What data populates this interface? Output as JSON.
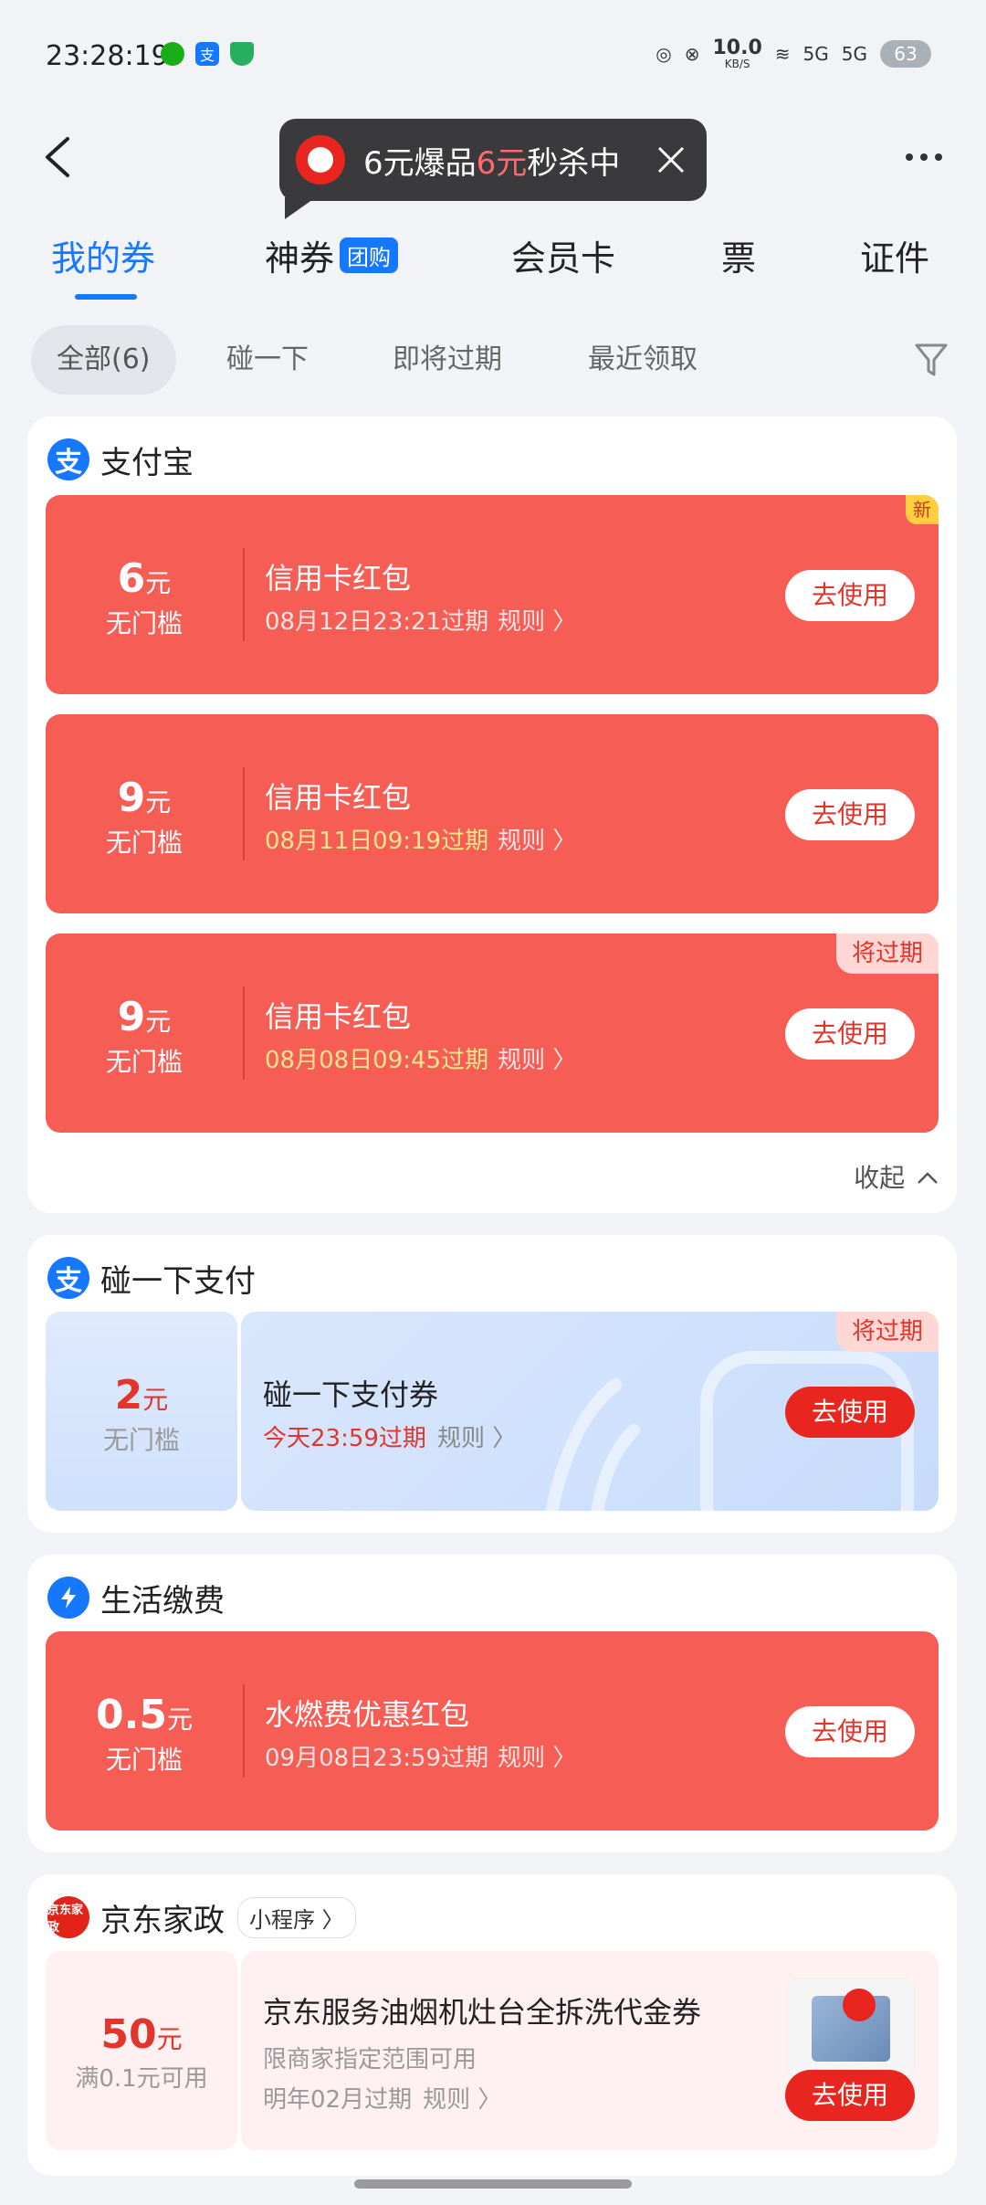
{
  "status_bar": {
    "time": "23:28:19",
    "net_speed_value": "10.0",
    "net_speed_unit": "KB/S",
    "signal_1": "5G",
    "signal_2": "5G",
    "battery": "63"
  },
  "promo": {
    "part1": "6元爆品",
    "part2": "6元",
    "part3": "秒杀中"
  },
  "tabs": [
    {
      "label": "我的券",
      "active": true
    },
    {
      "label": "神券",
      "tag": "团购"
    },
    {
      "label": "会员卡"
    },
    {
      "label": "票"
    },
    {
      "label": "证件"
    }
  ],
  "filters": [
    {
      "label": "全部(6)",
      "active": true
    },
    {
      "label": "碰一下"
    },
    {
      "label": "即将过期"
    },
    {
      "label": "最近领取"
    }
  ],
  "sections": {
    "alipay": {
      "name": "支付宝",
      "logo_char": "支",
      "coupons": [
        {
          "amount": "6",
          "unit": "元",
          "cond": "无门槛",
          "title": "信用卡红包",
          "expiry": "08月12日23:21过期",
          "rule": "规则 〉",
          "button": "去使用",
          "badge": "新"
        },
        {
          "amount": "9",
          "unit": "元",
          "cond": "无门槛",
          "title": "信用卡红包",
          "expiry": "08月11日09:19过期",
          "rule": "规则 〉",
          "button": "去使用"
        },
        {
          "amount": "9",
          "unit": "元",
          "cond": "无门槛",
          "title": "信用卡红包",
          "expiry": "08月08日09:45过期",
          "rule": "规则 〉",
          "button": "去使用",
          "badge": "将过期"
        }
      ],
      "collapse_label": "收起"
    },
    "nfc": {
      "name": "碰一下支付",
      "logo_char": "支",
      "coupon": {
        "amount": "2",
        "unit": "元",
        "cond": "无门槛",
        "title": "碰一下支付券",
        "expiry": "今天23:59过期",
        "rule": "规则 〉",
        "button": "去使用",
        "badge": "将过期"
      }
    },
    "life": {
      "name": "生活缴费",
      "coupon": {
        "amount": "0.5",
        "unit": "元",
        "cond": "无门槛",
        "title": "水燃费优惠红包",
        "expiry": "09月08日23:59过期",
        "rule": "规则 〉",
        "button": "去使用"
      }
    },
    "jd": {
      "name": "京东家政",
      "logo_text": "京东家政",
      "mini_tag": "小程序 〉",
      "coupon": {
        "amount": "50",
        "unit": "元",
        "cond": "满0.1元可用",
        "title": "京东服务油烟机灶台全拆洗代金券",
        "sub": "限商家指定范围可用",
        "expiry": "明年02月过期",
        "rule": "规则 〉",
        "button": "去使用"
      }
    }
  }
}
